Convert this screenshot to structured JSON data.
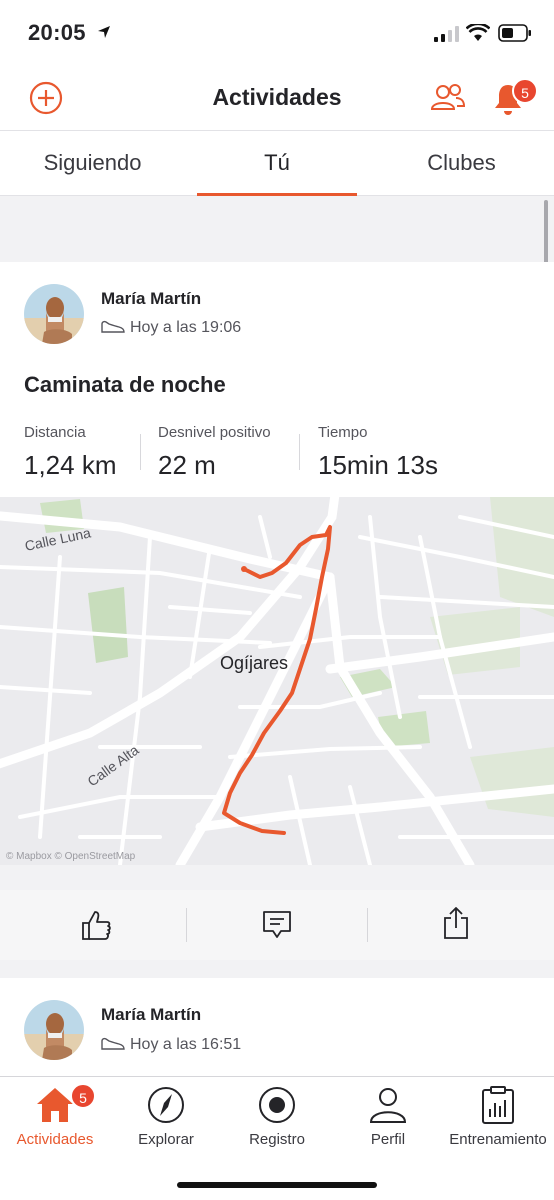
{
  "status_bar": {
    "time": "20:05"
  },
  "header": {
    "title": "Actividades",
    "notifications_count": "5"
  },
  "tabs": [
    {
      "label": "Siguiendo",
      "active": false
    },
    {
      "label": "Tú",
      "active": true
    },
    {
      "label": "Clubes",
      "active": false
    }
  ],
  "activities": [
    {
      "athlete": "María Martín",
      "when": "Hoy a las 19:06",
      "title": "Caminata de noche",
      "stats": [
        {
          "label": "Distancia",
          "value": "1,24 km"
        },
        {
          "label": "Desnivel positivo",
          "value": "22 m"
        },
        {
          "label": "Tiempo",
          "value": "15min 13s"
        }
      ],
      "map": {
        "place": "Ogíjares",
        "streets": [
          "Calle Luna",
          "Calle Alta"
        ],
        "attribution": "© Mapbox © OpenStreetMap"
      }
    },
    {
      "athlete": "María Martín",
      "when": "Hoy a las 16:51"
    }
  ],
  "bottom_nav": [
    {
      "label": "Actividades",
      "icon": "home-icon",
      "active": true,
      "badge": "5"
    },
    {
      "label": "Explorar",
      "icon": "compass-icon",
      "active": false
    },
    {
      "label": "Registro",
      "icon": "record-icon",
      "active": false
    },
    {
      "label": "Perfil",
      "icon": "profile-icon",
      "active": false
    },
    {
      "label": "Entrenamiento",
      "icon": "training-icon",
      "active": false
    }
  ],
  "colors": {
    "accent": "#e8582e",
    "badge": "#e8462f"
  }
}
